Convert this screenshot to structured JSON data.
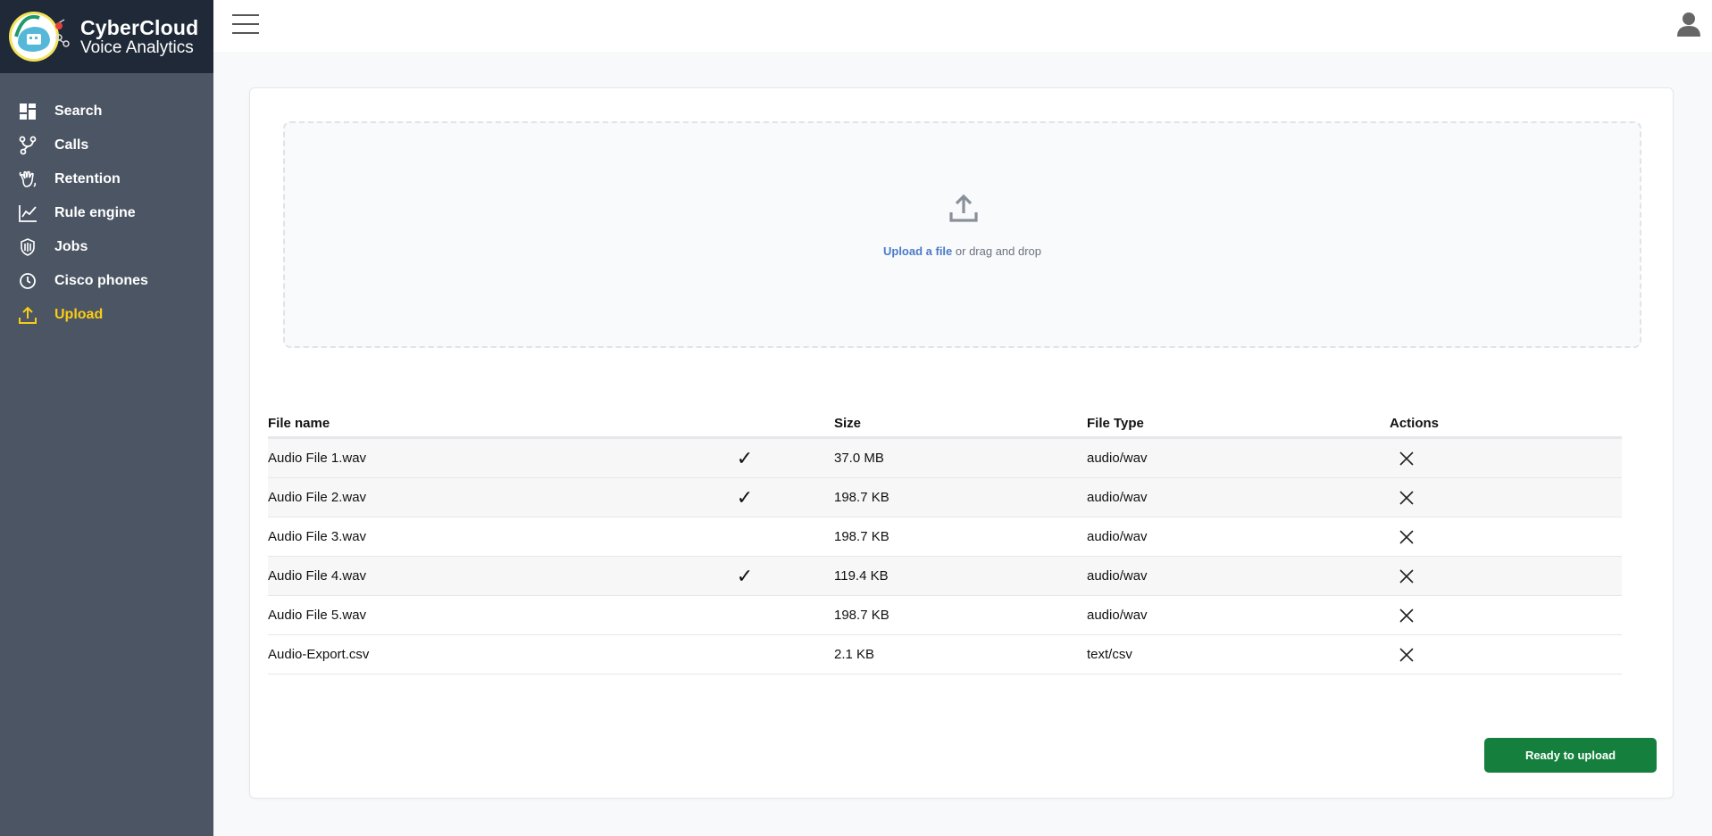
{
  "brand": {
    "title": "CyberCloud",
    "subtitle": "Voice Analytics"
  },
  "sidebar": {
    "items": [
      {
        "label": "Search",
        "icon": "grid-icon"
      },
      {
        "label": "Calls",
        "icon": "branch-icon"
      },
      {
        "label": "Retention",
        "icon": "hand-icon"
      },
      {
        "label": "Rule engine",
        "icon": "line-chart-icon"
      },
      {
        "label": "Jobs",
        "icon": "shield-icon"
      },
      {
        "label": "Cisco phones",
        "icon": "clock-icon"
      },
      {
        "label": "Upload",
        "icon": "upload-icon",
        "active": true
      }
    ]
  },
  "dropzone": {
    "link_text": "Upload a file",
    "rest_text": " or drag and drop"
  },
  "table": {
    "headers": {
      "name": "File name",
      "size": "Size",
      "type": "File Type",
      "actions": "Actions"
    },
    "rows": [
      {
        "name": "Audio File 1.wav",
        "check": "✓",
        "size": "37.0 MB",
        "type": "audio/wav"
      },
      {
        "name": "Audio File 2.wav",
        "check": "✓",
        "size": "198.7 KB",
        "type": "audio/wav"
      },
      {
        "name": "Audio File 3.wav",
        "check": "",
        "size": "198.7 KB",
        "type": "audio/wav"
      },
      {
        "name": "Audio File 4.wav",
        "check": "✓",
        "size": "119.4 KB",
        "type": "audio/wav"
      },
      {
        "name": "Audio File 5.wav",
        "check": "",
        "size": "198.7 KB",
        "type": "audio/wav"
      },
      {
        "name": "Audio-Export.csv",
        "check": "",
        "size": "2.1 KB",
        "type": "text/csv"
      }
    ]
  },
  "ready_button": "Ready to upload",
  "colors": {
    "accent": "#facc15",
    "primary_button": "#15803d",
    "link": "#4b7bc9",
    "sidebar": "#4b5563",
    "brand_bar": "#1f2937"
  }
}
